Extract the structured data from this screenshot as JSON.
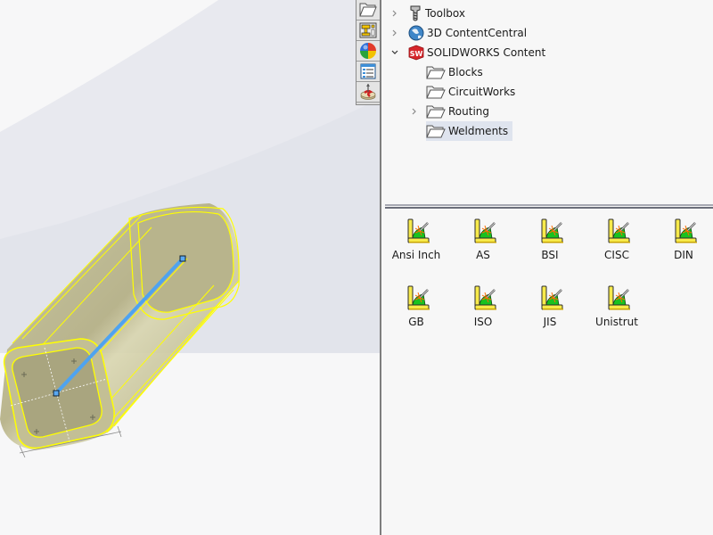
{
  "viewport": {
    "background_colors": [
      "#f7f7f8",
      "#e6e8ef",
      "#dde0e9"
    ],
    "model": {
      "name": "rectangular-tube-weldment",
      "highlight_color": "#ffff00",
      "body_color": "#b9b58a",
      "path_color": "#4ea3f0"
    }
  },
  "taskpane_tabs": [
    {
      "name": "design-library",
      "icon": "open-folder-icon"
    },
    {
      "name": "file-explorer",
      "icon": "file-explorer-icon"
    },
    {
      "name": "appearances",
      "icon": "appearances-sphere-icon"
    },
    {
      "name": "custom-properties",
      "icon": "custom-properties-icon"
    },
    {
      "name": "solidworks-resources",
      "icon": "resources-icon"
    }
  ],
  "tree": {
    "items": [
      {
        "label": "Toolbox",
        "icon": "toolbox-bolt-icon",
        "expander": "collapsed",
        "level": 0
      },
      {
        "label": "3D ContentCentral",
        "icon": "globe-icon",
        "expander": "collapsed",
        "level": 0
      },
      {
        "label": "SOLIDWORKS Content",
        "icon": "solidworks-logo-icon",
        "expander": "expanded",
        "level": 0
      },
      {
        "label": "Blocks",
        "icon": "folder-icon",
        "expander": "none",
        "level": 1
      },
      {
        "label": "CircuitWorks",
        "icon": "folder-icon",
        "expander": "none",
        "level": 1
      },
      {
        "label": "Routing",
        "icon": "folder-icon",
        "expander": "collapsed",
        "level": 1
      },
      {
        "label": "Weldments",
        "icon": "folder-icon",
        "expander": "none",
        "level": 1,
        "selected": true
      }
    ]
  },
  "library_items": [
    {
      "label": "Ansi Inch",
      "icon": "weldment-standard-icon"
    },
    {
      "label": "AS",
      "icon": "weldment-standard-icon"
    },
    {
      "label": "BSI",
      "icon": "weldment-standard-icon"
    },
    {
      "label": "CISC",
      "icon": "weldment-standard-icon"
    },
    {
      "label": "DIN",
      "icon": "weldment-standard-icon"
    },
    {
      "label": "GB",
      "icon": "weldment-standard-icon"
    },
    {
      "label": "ISO",
      "icon": "weldment-standard-icon"
    },
    {
      "label": "JIS",
      "icon": "weldment-standard-icon"
    },
    {
      "label": "Unistrut",
      "icon": "weldment-standard-icon"
    }
  ]
}
